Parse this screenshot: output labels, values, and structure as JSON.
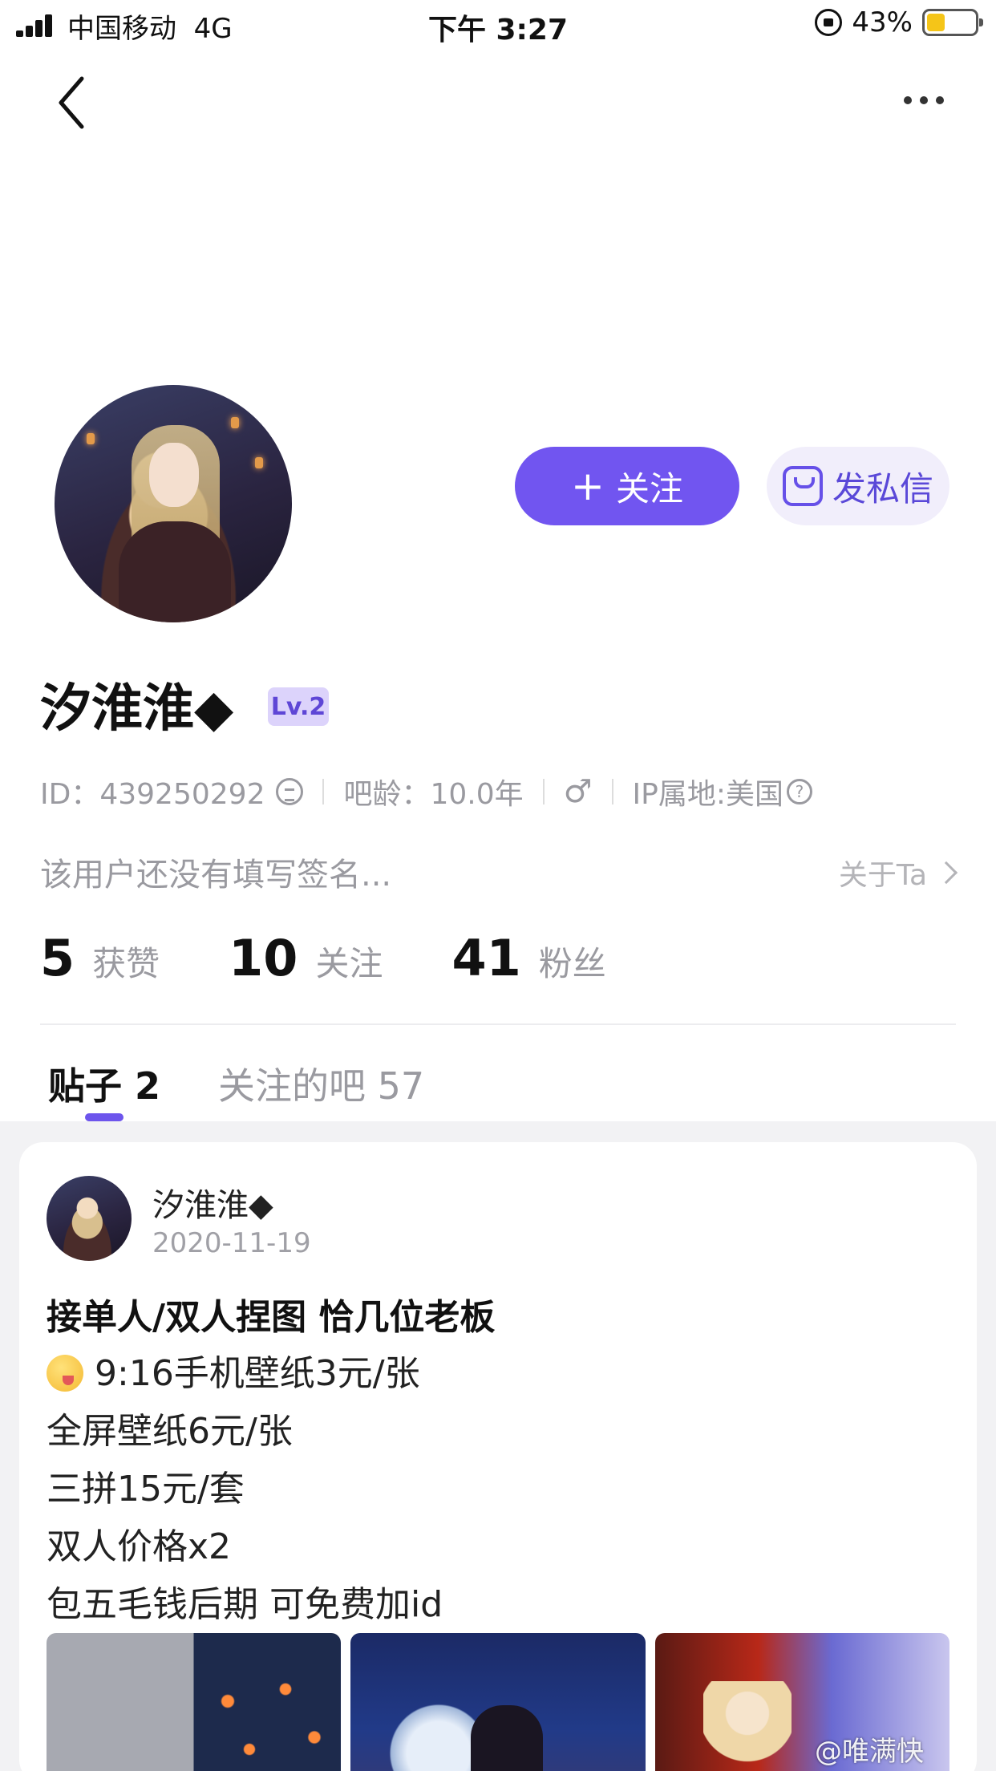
{
  "status_bar": {
    "carrier": "中国移动",
    "network": "4G",
    "time": "下午 3:27",
    "battery": "43%",
    "battery_level": 0.43
  },
  "profile": {
    "follow_label": "关注",
    "message_label": "发私信",
    "username": "汐淮淮◆",
    "level": "Lv.2",
    "id_text": "ID：439250292",
    "age_text": "吧龄：10.0年",
    "gender_icon": "male-icon",
    "ip_text": "IP属地:美国",
    "signature": "该用户还没有填写签名...",
    "about_label": "关于Ta",
    "stats": [
      {
        "num": "5",
        "label": "获赞"
      },
      {
        "num": "10",
        "label": "关注"
      },
      {
        "num": "41",
        "label": "粉丝"
      }
    ]
  },
  "tabs": [
    {
      "label": "贴子 2",
      "active": true
    },
    {
      "label": "关注的吧 57",
      "active": false
    }
  ],
  "post": {
    "author": "汐淮淮◆",
    "date": "2020-11-19",
    "title": "接单人/双人捏图 恰几位老板",
    "lines": [
      "9:16手机壁纸3元/张",
      "全屏壁纸6元/张",
      "三拼15元/套",
      "双人价格x2",
      "包五毛钱后期 可免费加id"
    ]
  },
  "watermark": "@唯满快",
  "colors": {
    "accent": "#7155f0",
    "accent_light": "#f1eefb",
    "badge_bg": "#dcd3fb",
    "muted_text": "#9a9aa0"
  }
}
